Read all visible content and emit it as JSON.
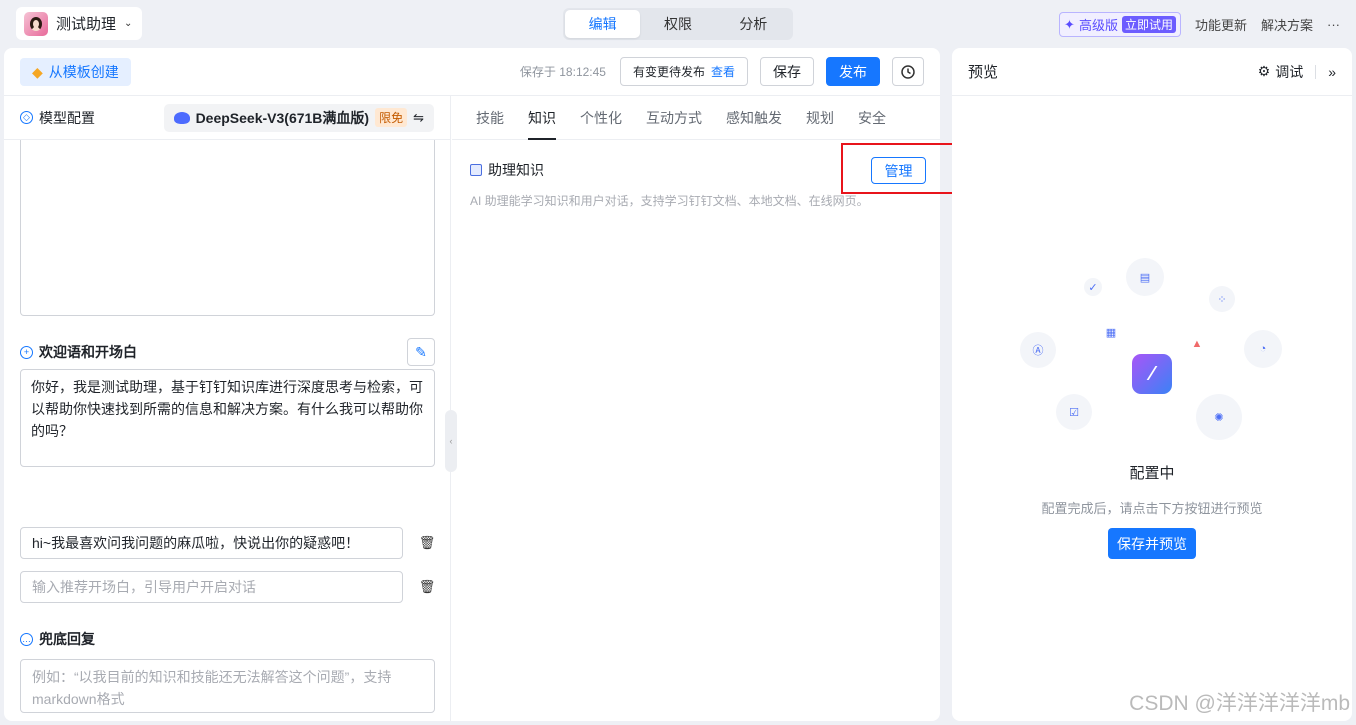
{
  "app": {
    "title": "测试助理"
  },
  "mode_tabs": [
    "编辑",
    "权限",
    "分析"
  ],
  "top_right": {
    "pro_label": "高级版",
    "trial_label": "立即试用",
    "updates": "功能更新",
    "solutions": "解决方案",
    "more": "···"
  },
  "toolbar": {
    "template_btn": "从模板创建",
    "saved_at": "保存于 18:12:45",
    "pending_text": "有变更待发布",
    "pending_link": "查看",
    "save": "保存",
    "publish": "发布"
  },
  "model": {
    "section": "模型配置",
    "name": "DeepSeek-V3(671B满血版)",
    "badge": "限免",
    "switch_icon": "⇋"
  },
  "welcome": {
    "section": "欢迎语和开场白",
    "text": "你好，我是测试助理，基于钉钉知识库进行深度思考与检索，可以帮助你快速找到所需的信息和解决方案。有什么我可以帮助你的吗？",
    "opener_1": "hi~我最喜欢问我问题的麻瓜啦，快说出你的疑惑吧！",
    "opener_placeholder": "输入推荐开场白，引导用户开启对话"
  },
  "fallback": {
    "section": "兜底回复",
    "placeholder": "例如：“以我目前的知识和技能还无法解答这个问题”，支持markdown格式"
  },
  "config_tabs": [
    "技能",
    "知识",
    "个性化",
    "互动方式",
    "感知触发",
    "规划",
    "安全"
  ],
  "knowledge": {
    "title": "助理知识",
    "manage": "管理",
    "desc": "AI 助理能学习知识和用户对话，支持学习钉钉文档、本地文档、在线网页。"
  },
  "preview": {
    "title": "预览",
    "debug": "调试",
    "status": "配置中",
    "desc": "配置完成后，请点击下方按钮进行预览",
    "button": "保存并预览"
  },
  "watermark": "CSDN @洋洋洋洋洋mb"
}
